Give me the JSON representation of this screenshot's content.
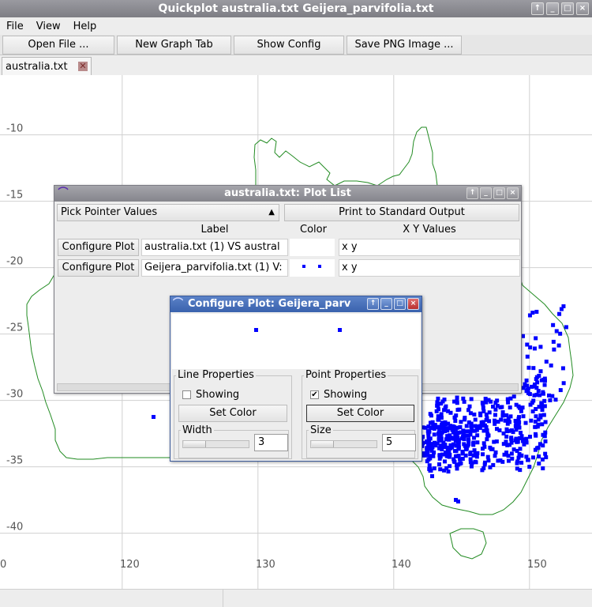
{
  "window": {
    "title": "Quickplot australia.txt Geijera_parvifolia.txt",
    "controls": [
      "↑",
      "_",
      "□",
      "×"
    ]
  },
  "menu": {
    "items": [
      "File",
      "View",
      "Help"
    ]
  },
  "toolbar": {
    "open_file": "Open File ...",
    "new_graph_tab": "New Graph Tab",
    "show_config": "Show Config",
    "save_png": "Save PNG Image ..."
  },
  "tabs": [
    {
      "label": "australia.txt",
      "close_icon": "close-icon"
    }
  ],
  "plot_list_window": {
    "title": "australia.txt: Plot List",
    "pointer_combo": "Pick Pointer Values",
    "print_button": "Print to Standard Output",
    "headers": {
      "label": "Label",
      "color": "Color",
      "xy": "X Y Values"
    },
    "rows": [
      {
        "button": "Configure Plot",
        "label": "australia.txt (1) VS austral",
        "xy": "x y",
        "color_style": "line",
        "color": "#228b22"
      },
      {
        "button": "Configure Plot",
        "label": "Geijera_parvifolia.txt (1) V:",
        "xy": "x y",
        "color_style": "points",
        "color": "#0000ff"
      }
    ]
  },
  "configure_window": {
    "title": "Configure Plot: Geijera_parv",
    "line_properties": {
      "legend": "Line Properties",
      "showing_label": "Showing",
      "showing": false,
      "set_color": "Set Color",
      "width_label": "Width",
      "width_value": "3"
    },
    "point_properties": {
      "legend": "Point Properties",
      "showing_label": "Showing",
      "showing": true,
      "set_color": "Set Color",
      "size_label": "Size",
      "size_value": "5"
    }
  },
  "chart_data": {
    "type": "scatter",
    "x_ticks": [
      "0",
      "120",
      "130",
      "140",
      "150"
    ],
    "y_ticks": [
      "-10",
      "-15",
      "-20",
      "-25",
      "-30",
      "-35",
      "-40"
    ],
    "xlim": [
      110,
      154
    ],
    "ylim": [
      -43,
      -8
    ],
    "grid": true,
    "series": [
      {
        "name": "australia.txt (1) VS austral",
        "color": "#228b22",
        "style": "line"
      },
      {
        "name": "Geijera_parvifolia.txt (1) V:",
        "color": "#0000ff",
        "style": "points"
      }
    ]
  }
}
